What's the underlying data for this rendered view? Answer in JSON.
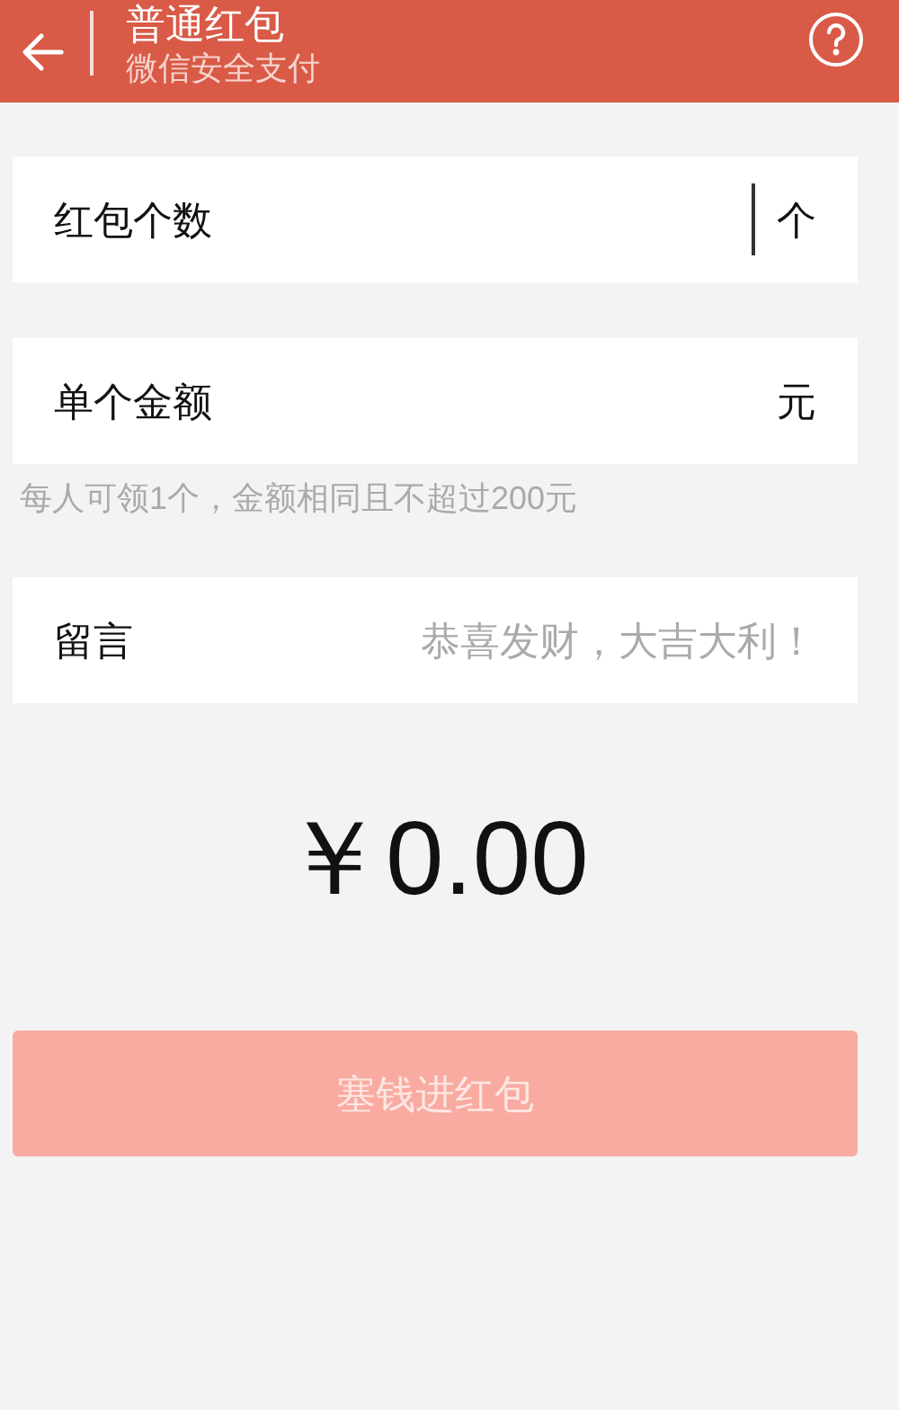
{
  "header": {
    "title": "普通红包",
    "subtitle": "微信安全支付"
  },
  "fields": [
    {
      "label": "红包个数",
      "unit": "个",
      "focused": true
    },
    {
      "label": "单个金额",
      "unit": "元",
      "focused": false
    }
  ],
  "hint": "每人可领1个，金额相同且不超过200元",
  "message": {
    "label": "留言",
    "placeholder": "恭喜发财，大吉大利！"
  },
  "amount": "￥0.00",
  "submit": {
    "label": "塞钱进红包",
    "disabled": true
  }
}
